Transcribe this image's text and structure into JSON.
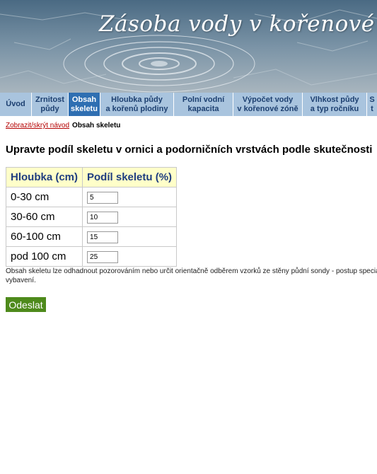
{
  "banner": {
    "title": "Zásoba vody v kořenové zóně"
  },
  "nav": {
    "items": [
      {
        "label": "Úvod",
        "active": false
      },
      {
        "label": "Zrnitost\npůdy",
        "active": false
      },
      {
        "label": "Obsah\nskeletu",
        "active": true
      },
      {
        "label": "Hloubka půdy\na kořenů plodiny",
        "active": false
      },
      {
        "label": "Polní vodní\nkapacita",
        "active": false
      },
      {
        "label": "Výpočet vody\nv kořenové zóně",
        "active": false
      },
      {
        "label": "Vlhkost půdy\na typ ročníku",
        "active": false
      },
      {
        "label": "S\nt",
        "active": false
      }
    ]
  },
  "subbar": {
    "toggle_link": "Zobrazit/skrýt návod",
    "current": "Obsah skeletu"
  },
  "heading": "Upravte podíl skeletu v ornici a podorničních vrstvách podle skutečnosti",
  "table": {
    "headers": [
      "Hloubka (cm)",
      "Podíl skeletu (%)"
    ],
    "rows": [
      {
        "depth": "0-30 cm",
        "value": "5"
      },
      {
        "depth": "30-60 cm",
        "value": "10"
      },
      {
        "depth": "60-100 cm",
        "value": "15"
      },
      {
        "depth": "pod 100 cm",
        "value": "25"
      }
    ]
  },
  "note": "Obsah skeletu lze odhadnout pozorováním nebo určit orientačně odběrem vzorků ze stěny půdní sondy - postup speciální vybavení.",
  "submit_label": "Odeslat"
}
